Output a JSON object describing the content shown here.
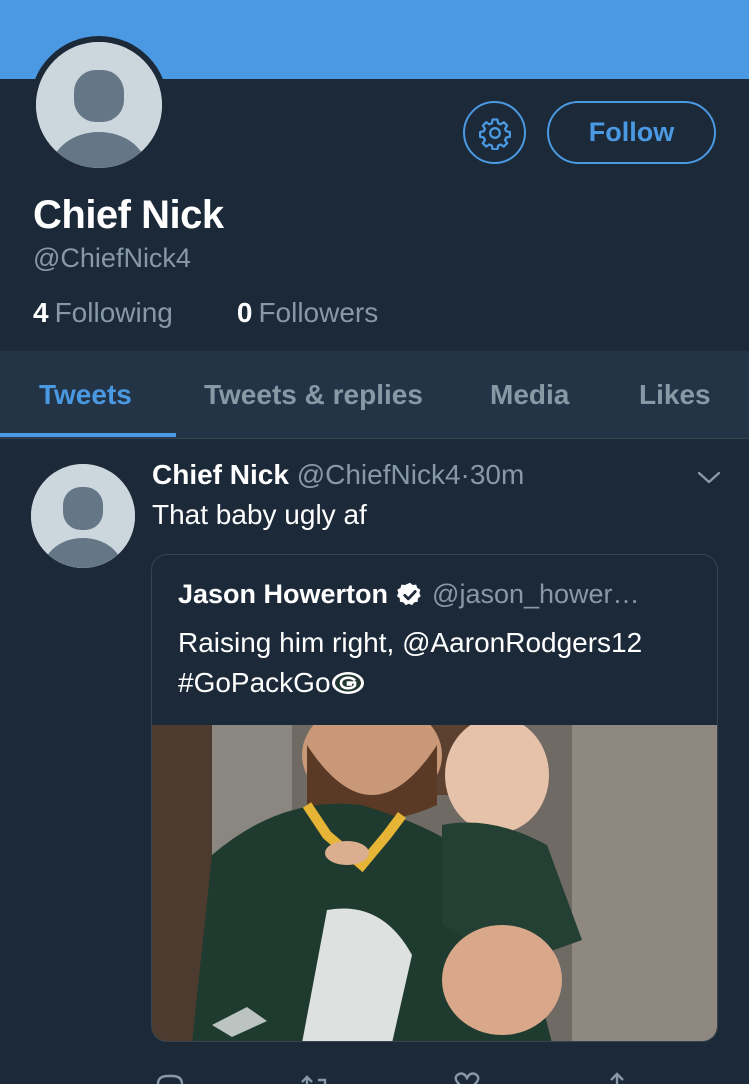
{
  "profile": {
    "display_name": "Chief Nick",
    "handle": "@ChiefNick4",
    "following_count": "4",
    "following_label": "Following",
    "followers_count": "0",
    "followers_label": "Followers",
    "follow_label": "Follow"
  },
  "tabs": [
    {
      "label": "Tweets",
      "active": true
    },
    {
      "label": "Tweets & replies",
      "active": false
    },
    {
      "label": "Media",
      "active": false
    },
    {
      "label": "Likes",
      "active": false
    }
  ],
  "tweet": {
    "name": "Chief Nick",
    "handle": "@ChiefNick4",
    "separator": "·",
    "time": "30m",
    "text": "That baby ugly af",
    "quote": {
      "name": "Jason Howerton",
      "handle": "@jason_hower…",
      "text_line1": "Raising him right, @AaronRodgers12",
      "text_line2": "#GoPackGo"
    }
  },
  "colors": {
    "accent": "#4a99e2",
    "background": "#1c2938",
    "tabs_background": "#243447",
    "secondary_text": "#8899a6"
  },
  "icons": [
    "gear-icon",
    "chevron-down-icon",
    "verified-badge-icon",
    "packers-logo-icon",
    "reply-icon",
    "retweet-icon",
    "like-icon",
    "share-icon"
  ]
}
